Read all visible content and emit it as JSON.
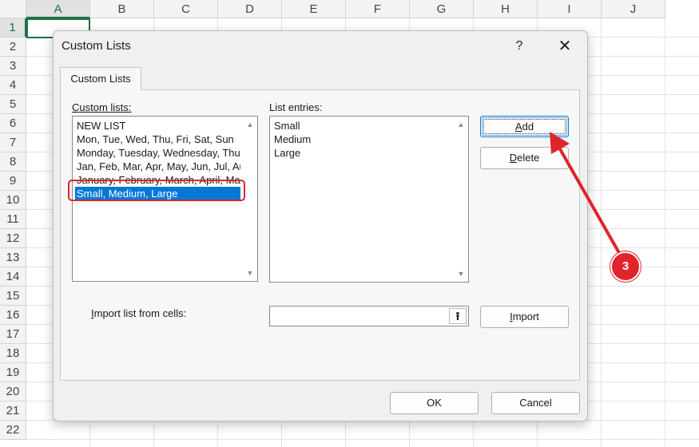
{
  "spreadsheet": {
    "columns": [
      "A",
      "B",
      "C",
      "D",
      "E",
      "F",
      "G",
      "H",
      "I",
      "J"
    ],
    "rows": [
      "1",
      "2",
      "3",
      "4",
      "5",
      "6",
      "7",
      "8",
      "9",
      "10",
      "11",
      "12",
      "13",
      "14",
      "15",
      "16",
      "17",
      "18",
      "19",
      "20",
      "21",
      "22"
    ],
    "active_column": "A",
    "active_row": "1"
  },
  "dialog": {
    "title": "Custom Lists",
    "help_label": "?",
    "close_label": "✕",
    "tab_label": "Custom Lists",
    "custom_lists_label": "Custom lists:",
    "custom_lists": [
      "NEW LIST",
      "Mon, Tue, Wed, Thu, Fri, Sat, Sun",
      "Monday, Tuesday, Wednesday, Thursday, Friday, Saturday, Sunday",
      "Jan, Feb, Mar, Apr, May, Jun, Jul, Aug, Sep, Oct, Nov, Dec",
      "January, February, March, April, May, June, July, August, September, October, November, December",
      "Small, Medium, Large"
    ],
    "selected_list_index": 5,
    "list_entries_label": "List entries:",
    "list_entries": [
      "Small",
      "Medium",
      "Large"
    ],
    "add_label_prefix": "",
    "add_label_underlined": "A",
    "add_label_rest": "dd",
    "delete_label_underlined": "D",
    "delete_label_rest": "elete",
    "import_from_label_underlined": "I",
    "import_from_label_rest": "mport list from cells:",
    "import_input_value": "",
    "import_label_underlined": "I",
    "import_label_rest": "mport",
    "ok_label": "OK",
    "cancel_label": "Cancel",
    "scroll_up_glyph": "▲",
    "scroll_down_glyph": "▼",
    "collapse_glyph": "⭱"
  },
  "annotation": {
    "step_number": "3",
    "color": "#e0242b"
  }
}
